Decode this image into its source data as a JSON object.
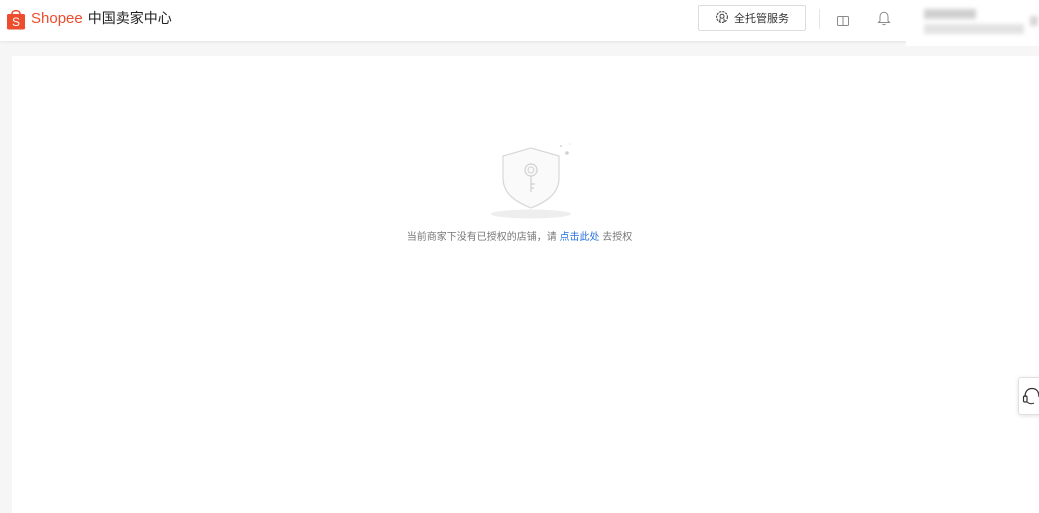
{
  "header": {
    "brand_name": "Shopee",
    "brand_subtitle": "中国卖家中心",
    "managed_service_label": "全托管服务",
    "icons": {
      "brand": "shopee-bag-icon",
      "managed_service": "badge-icon",
      "book": "book-icon",
      "notification": "bell-icon",
      "user": "blurred-user-info"
    }
  },
  "main": {
    "empty_state": {
      "icon": "shield-key-icon",
      "message_before": "当前商家下没有已授权的店铺，请",
      "link_text": "点击此处",
      "message_after": "去授权"
    }
  },
  "floating": {
    "helper_icon": "headset-icon"
  },
  "colors": {
    "brand": "#ee4d2d",
    "link": "#2673dd",
    "background": "#f6f6f6"
  }
}
